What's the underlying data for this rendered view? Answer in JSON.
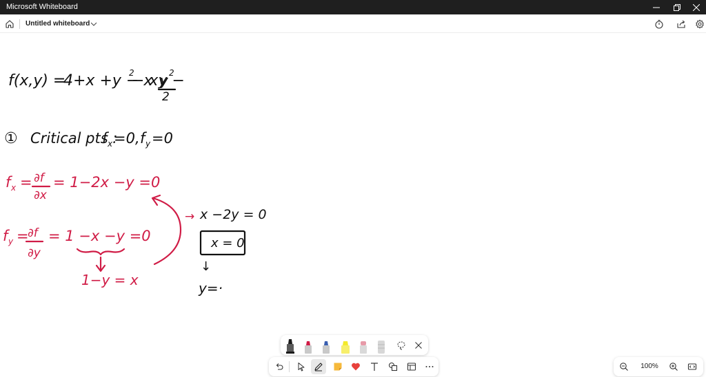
{
  "window": {
    "app_title": "Microsoft Whiteboard"
  },
  "header": {
    "document_title": "Untitled whiteboard"
  },
  "whiteboard": {
    "line1": "f(x,y) = 4+x + y − x² − xy − y²/2",
    "line1_lhs": "f(x,y) =",
    "line1_rhs": "4+x +y − x",
    "line1_sq": "2",
    "line1_mid": " − xy − ",
    "line1_frac_num": "y",
    "line1_frac_sup": "2",
    "line1_frac_den": "2",
    "step": "①",
    "critical_label": "Critical pts :",
    "critical_cond1": "f",
    "critical_cond1_sub": "x",
    "critical_cond1_rest": "=0,",
    "critical_cond2": "f",
    "critical_cond2_sub": "y",
    "critical_cond2_rest": "=0",
    "fx_lhs": "f",
    "fx_sub": "x",
    "fx_eq": "=",
    "fx_num": "∂f",
    "fx_den": "∂x",
    "fx_rhs": "=  1−2x −y  =0",
    "fy_lhs": "f",
    "fy_sub": "y",
    "fy_eq": "=",
    "fy_num": "∂f",
    "fy_den": "∂y",
    "fy_rhs": "=   1 −x −y  =0",
    "fy_derived": "1−y = x",
    "right_arrow": "→",
    "right_eq": "x −2y = 0",
    "boxed": "x = 0",
    "arrow_down": "↓",
    "y_partial": "y=·"
  },
  "pen_tray": {
    "pens": [
      {
        "name": "black-pen",
        "color": "#1b1b1b"
      },
      {
        "name": "red-pen",
        "color": "#d01c46"
      },
      {
        "name": "blue-pen",
        "color": "#3a5fb0"
      },
      {
        "name": "highlighter",
        "color": "#f3ea2b"
      },
      {
        "name": "pink-pen",
        "color": "#e79aa8"
      },
      {
        "name": "eraser",
        "color": "#c9c9c9"
      }
    ]
  },
  "zoom": {
    "level": "100%"
  }
}
